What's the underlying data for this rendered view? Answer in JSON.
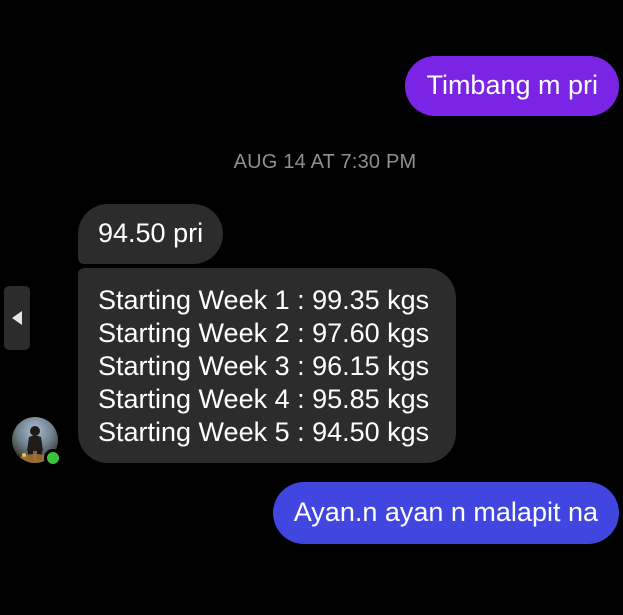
{
  "thread": {
    "messages": [
      {
        "direction": "outgoing",
        "text": "Timbang m pri"
      },
      {
        "direction": "incoming",
        "text": "94.50 pri"
      },
      {
        "direction": "incoming",
        "lines": [
          "Starting Week 1 : 99.35 kgs",
          "Starting Week 2 : 97.60 kgs",
          "Starting Week 3 : 96.15 kgs",
          "Starting Week 4 : 95.85 kgs",
          "Starting Week 5 : 94.50 kgs"
        ]
      },
      {
        "direction": "outgoing",
        "text": "Ayan.n ayan n malapit na"
      }
    ],
    "timestamp": "AUG 14 AT 7:30 PM"
  },
  "colors": {
    "background": "#000000",
    "outgoing_purple": "#7a24e6",
    "outgoing_blue": "#4146e0",
    "incoming_bubble": "#2c2c2c",
    "timestamp_text": "#8f8f8f",
    "online_indicator": "#3cc23c"
  },
  "icons": {
    "side_handle": "caret-left-icon",
    "contact_avatar": "avatar",
    "presence": "online-status-icon"
  }
}
